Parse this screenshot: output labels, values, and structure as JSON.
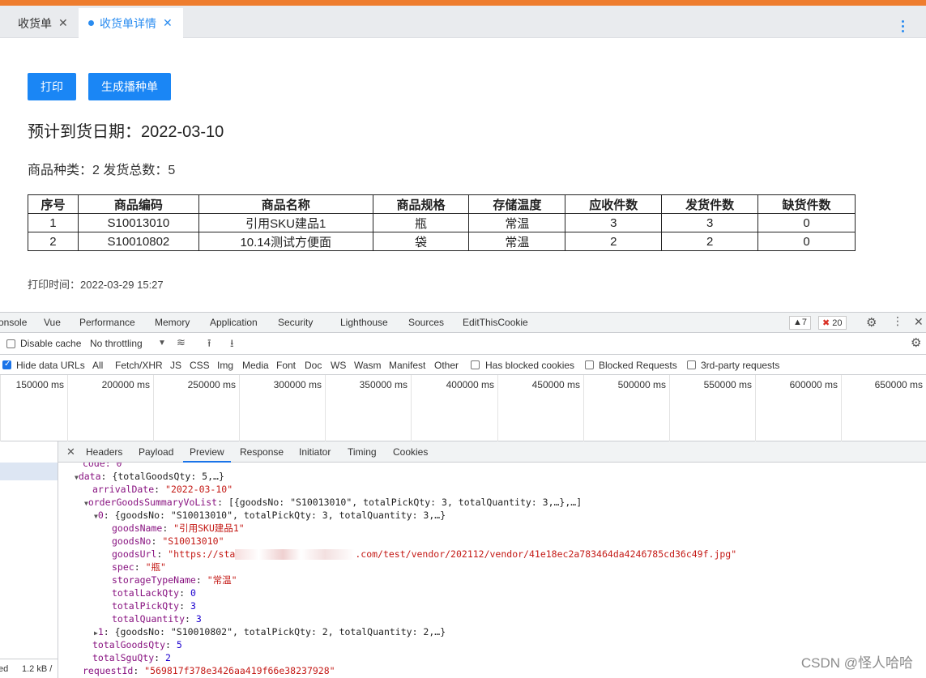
{
  "tabs": [
    {
      "label": "收货单"
    },
    {
      "label": "收货单详情"
    }
  ],
  "buttons": {
    "print": "打印",
    "generate": "生成播种单"
  },
  "arrival_date": "预计到货日期：2022-03-10",
  "summary": "商品种类：2 发货总数：5",
  "table": {
    "headers": [
      "序号",
      "商品编码",
      "商品名称",
      "商品规格",
      "存储温度",
      "应收件数",
      "发货件数",
      "缺货件数"
    ],
    "rows": [
      [
        "1",
        "S10013010",
        "引用SKU建品1",
        "瓶",
        "常温",
        "3",
        "3",
        "0"
      ],
      [
        "2",
        "S10010802",
        "10.14测试方便面",
        "袋",
        "常温",
        "2",
        "2",
        "0"
      ]
    ]
  },
  "print_time": "打印时间：2022-03-29 15:27",
  "devtools": {
    "tabs": [
      "onsole",
      "Vue",
      "Performance",
      "Memory",
      "Application",
      "Security",
      "Lighthouse",
      "Sources",
      "EditThisCookie"
    ],
    "warnings": "7",
    "errors": "20",
    "toolbar": {
      "disable_cache": "Disable cache",
      "throttling": "No throttling"
    },
    "filters": [
      "Hide data URLs",
      "All",
      "Fetch/XHR",
      "JS",
      "CSS",
      "Img",
      "Media",
      "Font",
      "Doc",
      "WS",
      "Wasm",
      "Manifest",
      "Other",
      "Has blocked cookies",
      "Blocked Requests",
      "3rd-party requests"
    ],
    "timeline_ticks": [
      "150000 ms",
      "200000 ms",
      "250000 ms",
      "300000 ms",
      "350000 ms",
      "400000 ms",
      "450000 ms",
      "500000 ms",
      "550000 ms",
      "600000 ms",
      "650000 ms"
    ],
    "detail_tabs": [
      "Headers",
      "Payload",
      "Preview",
      "Response",
      "Initiator",
      "Timing",
      "Cookies"
    ],
    "footer": {
      "a": "ed",
      "b": "1.2 kB /"
    },
    "preview": {
      "code_line": "code: 0",
      "data_key": "data",
      "data_summary": "{totalGoodsQty: 5,…}",
      "arrivalDate_key": "arrivalDate",
      "arrivalDate": "\"2022-03-10\"",
      "list_key": "orderGoodsSummaryVoList",
      "list_summary": "[{goodsNo: \"S10013010\", totalPickQty: 3, totalQuantity: 3,…},…]",
      "item0_key": "0",
      "item0_summary": "{goodsNo: \"S10013010\", totalPickQty: 3, totalQuantity: 3,…}",
      "goodsName": "\"引用SKU建品1\"",
      "goodsNo": "\"S10013010\"",
      "goodsUrl_prefix": "\"https://sta",
      "goodsUrl_suffix": ".com/test/vendor/202112/vendor/41e18ec2a783464da4246785cd36c49f.jpg\"",
      "spec": "\"瓶\"",
      "storageTypeName": "\"常温\"",
      "totalLackQty": "0",
      "totalPickQty": "3",
      "totalQuantity": "3",
      "item1_key": "1",
      "item1_summary": "{goodsNo: \"S10010802\", totalPickQty: 2, totalQuantity: 2,…}",
      "totalGoodsQty": "5",
      "totalSguQty": "2",
      "requestId": "\"569817f378e3426aa419f66e38237928\""
    }
  },
  "watermark": "CSDN @怪人哈哈"
}
